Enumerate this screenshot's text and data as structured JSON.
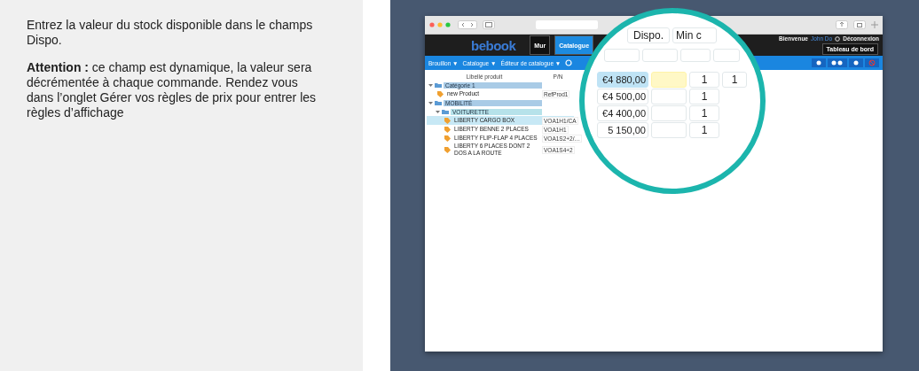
{
  "instructions": {
    "paragraphs": [
      "Entrez la valeur du stock disponible dans le champs Dispo.",
      "**Attention :** ce champ est dynamique, la valeur sera décrémentée à chaque commande. Rendez vous dans l’onglet Gérer vos règles de prix pour entrer les règles d’affichage"
    ]
  },
  "app": {
    "logo": "bebook",
    "nav_buttons": [
      {
        "label": "Mur",
        "selected": false
      },
      {
        "label": "Catalogue",
        "selected": true
      },
      {
        "label": "Tableau de bord",
        "selected": false
      }
    ],
    "welcome": "Bienvenue",
    "user": "John Do",
    "logout": "Déconnexion",
    "breadcrumbs": [
      "Brouillon ▼",
      "Catalogue ▼",
      "Éditeur de catalogue ▼"
    ]
  },
  "table": {
    "columns": [
      "Libellé produit",
      "P/N"
    ],
    "rows": [
      {
        "kind": "folder",
        "label": "Catégorie 1",
        "expanded": true,
        "children": [
          {
            "kind": "product",
            "label": "new Product",
            "pn": "RefProd1",
            "selected": false
          }
        ]
      },
      {
        "kind": "folder",
        "label": "MOBILITÉ",
        "expanded": true,
        "children": [
          {
            "kind": "folder",
            "label": "VOITURETTE",
            "expanded": true,
            "children": [
              {
                "kind": "product",
                "label": "LIBERTY CARGO BOX",
                "pn": "VOA1H1/CA",
                "selected": true
              },
              {
                "kind": "product",
                "label": "LIBERTY BENNE 2 PLACES",
                "pn": "VOA1H1",
                "selected": false
              },
              {
                "kind": "product",
                "label": "LIBERTY FLIP-FLAP 4 PLACES",
                "pn": "VOA1S2+2/…",
                "selected": false
              },
              {
                "kind": "product",
                "label": "LIBERTY 6 PLACES DONT 2 DOS A LA ROUTE",
                "pn": "VOA1S4+2",
                "selected": false
              }
            ]
          }
        ]
      }
    ]
  },
  "magnifier": {
    "header_fields": [
      "Dispo.",
      "Min c"
    ],
    "rows": [
      {
        "price": "€4 880,00",
        "qty": "1",
        "qty2": "1",
        "selected": true,
        "focused": true
      },
      {
        "price": "€4 500,00",
        "qty": "1",
        "selected": false,
        "focused": false
      },
      {
        "price": "€4 400,00",
        "qty": "1",
        "selected": false,
        "focused": false
      },
      {
        "price": "5 150,00",
        "qty": "1",
        "selected": false,
        "focused": false
      }
    ]
  }
}
